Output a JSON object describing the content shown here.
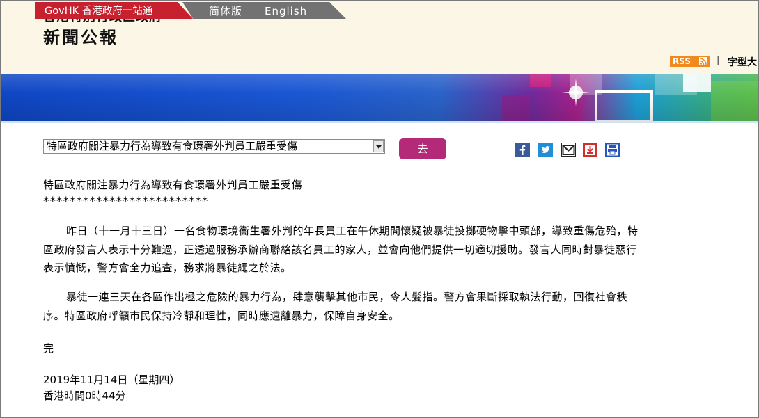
{
  "header": {
    "site_title": "香港特別行政區政府",
    "page_name": "新聞公報"
  },
  "nav": {
    "govhk": "GovHK 香港政府一站通",
    "simplified": "简体版",
    "english": "English",
    "rss": "RSS",
    "separator": "|",
    "font_size": "字型大"
  },
  "selector": {
    "selected": "特區政府關注暴力行為導致有食環署外判員工嚴重受傷",
    "go_label": "去"
  },
  "share": {
    "icons": [
      "facebook-icon",
      "twitter-icon",
      "mail-icon",
      "download-icon",
      "print-icon"
    ]
  },
  "article": {
    "headline": "特區政府關注暴力行為導致有食環署外判員工嚴重受傷",
    "stars": "*************************",
    "paragraphs": [
      "昨日（十一月十三日）一名食物環境衞生署外判的年長員工在午休期間懷疑被暴徒投擲硬物擊中頭部，導致重傷危殆，特區政府發言人表示十分難過，正透過服務承辦商聯絡該名員工的家人，並會向他們提供一切適切援助。發言人同時對暴徒惡行表示憤慨，警方會全力追查，務求將暴徒繩之於法。",
      "暴徒一連三天在各區作出極之危險的暴力行為，肆意襲擊其他市民，令人髮指。警方會果斷採取執法行動，回復社會秩序。特區政府呼籲市民保持冷靜和理性，同時應遠離暴力，保障自身安全。"
    ],
    "end": "完",
    "date": "2019年11月14日（星期四）",
    "time": "香港時間0時44分"
  },
  "colors": {
    "govhk_red": "#c7202f",
    "nav_grey": "#727272",
    "go_button": "#b52a78",
    "rss_orange": "#f08a1d",
    "header_bg": "#fbf6e6"
  }
}
